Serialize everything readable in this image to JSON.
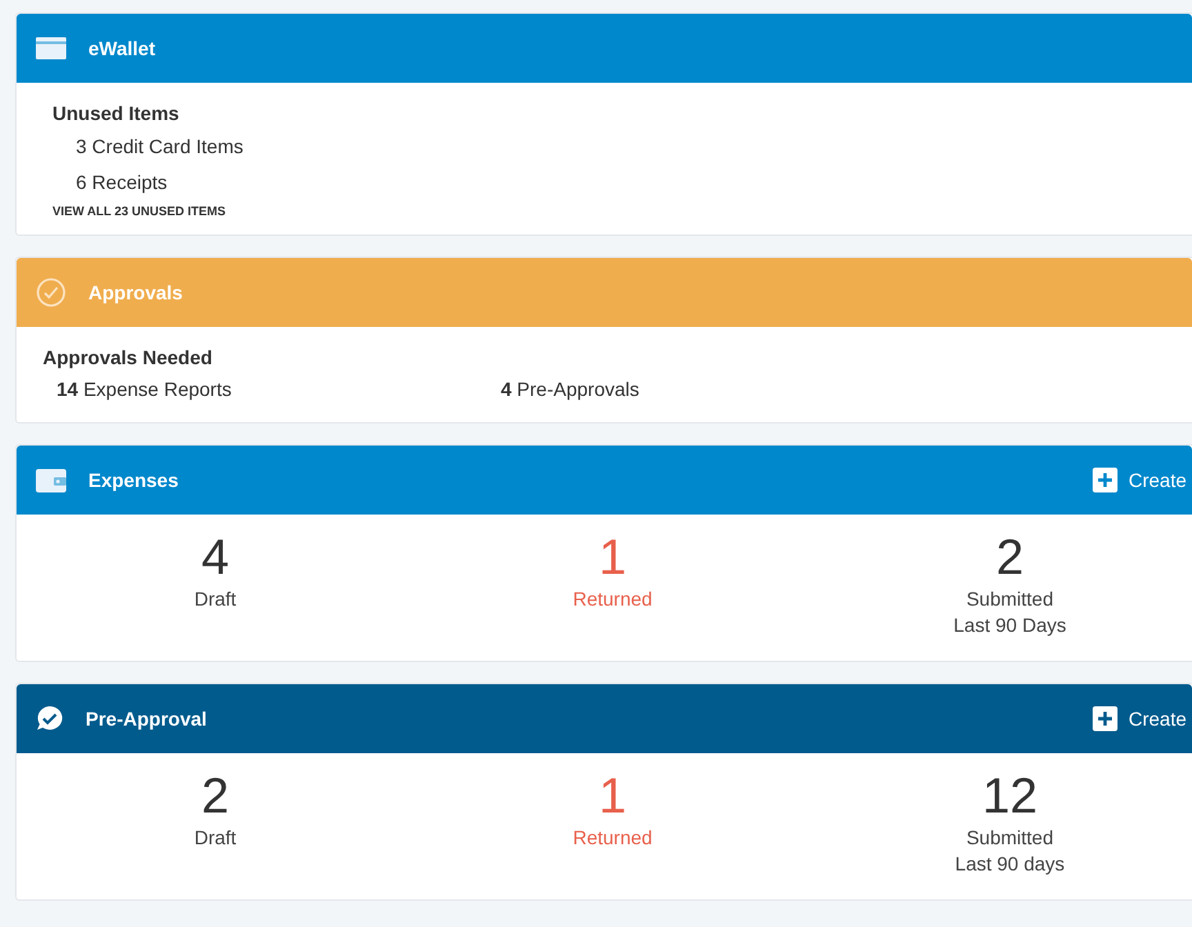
{
  "panels": [
    {
      "kind": "list",
      "title": "eWallet",
      "color": "#0088cc",
      "heading": "Unused Items",
      "items": [
        "3 Credit Card Items",
        "6 Receipts"
      ],
      "link": "VIEW ALL 23 UNUSED ITEMS"
    },
    {
      "kind": "approvals",
      "title": "Approvals",
      "color": "#f0ad4e",
      "heading": "Approvals Needed",
      "items": [
        "**14** Expense Reports",
        "**4** Pre-Approvals"
      ]
    },
    {
      "kind": "stats",
      "title": "Expenses",
      "color": "#0088cc",
      "action": "Create",
      "stats": [
        {
          "value": "4",
          "label": "Draft",
          "highlighted": false
        },
        {
          "value": "1",
          "label": "Returned",
          "highlighted": true
        },
        {
          "value": "2",
          "label": "Submitted",
          "sublabel": "Last 90 Days",
          "highlighted": false
        }
      ]
    },
    {
      "kind": "stats",
      "title": "Pre-Approval",
      "color": "#025b8d",
      "action": "Create",
      "stats": [
        {
          "value": "2",
          "label": "Draft",
          "highlighted": false
        },
        {
          "value": "1",
          "label": "Returned",
          "highlighted": true
        },
        {
          "value": "12",
          "label": "Submitted",
          "sublabel": "Last 90 days",
          "highlighted": false
        }
      ]
    }
  ]
}
